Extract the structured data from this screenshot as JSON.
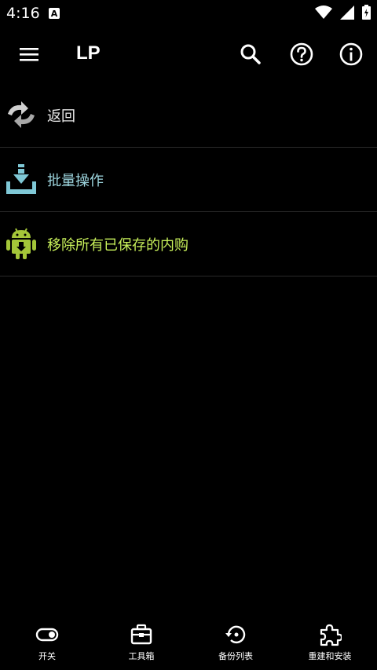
{
  "status_bar": {
    "time": "4:16",
    "notification_letter": "A"
  },
  "app_bar": {
    "title": "LP"
  },
  "menu": [
    {
      "label": "返回",
      "icon": "back-arrows-icon",
      "color": "#e8e8e8"
    },
    {
      "label": "批量操作",
      "icon": "download-tray-icon",
      "color": "#9ed6df"
    },
    {
      "label": "移除所有已保存的内购",
      "icon": "android-download-icon",
      "color": "#c7ef5a"
    }
  ],
  "bottom_nav": [
    {
      "label": "开关",
      "icon": "toggle-icon"
    },
    {
      "label": "工具箱",
      "icon": "toolbox-icon"
    },
    {
      "label": "备份列表",
      "icon": "restore-icon"
    },
    {
      "label": "重建和安装",
      "icon": "puzzle-icon"
    }
  ]
}
